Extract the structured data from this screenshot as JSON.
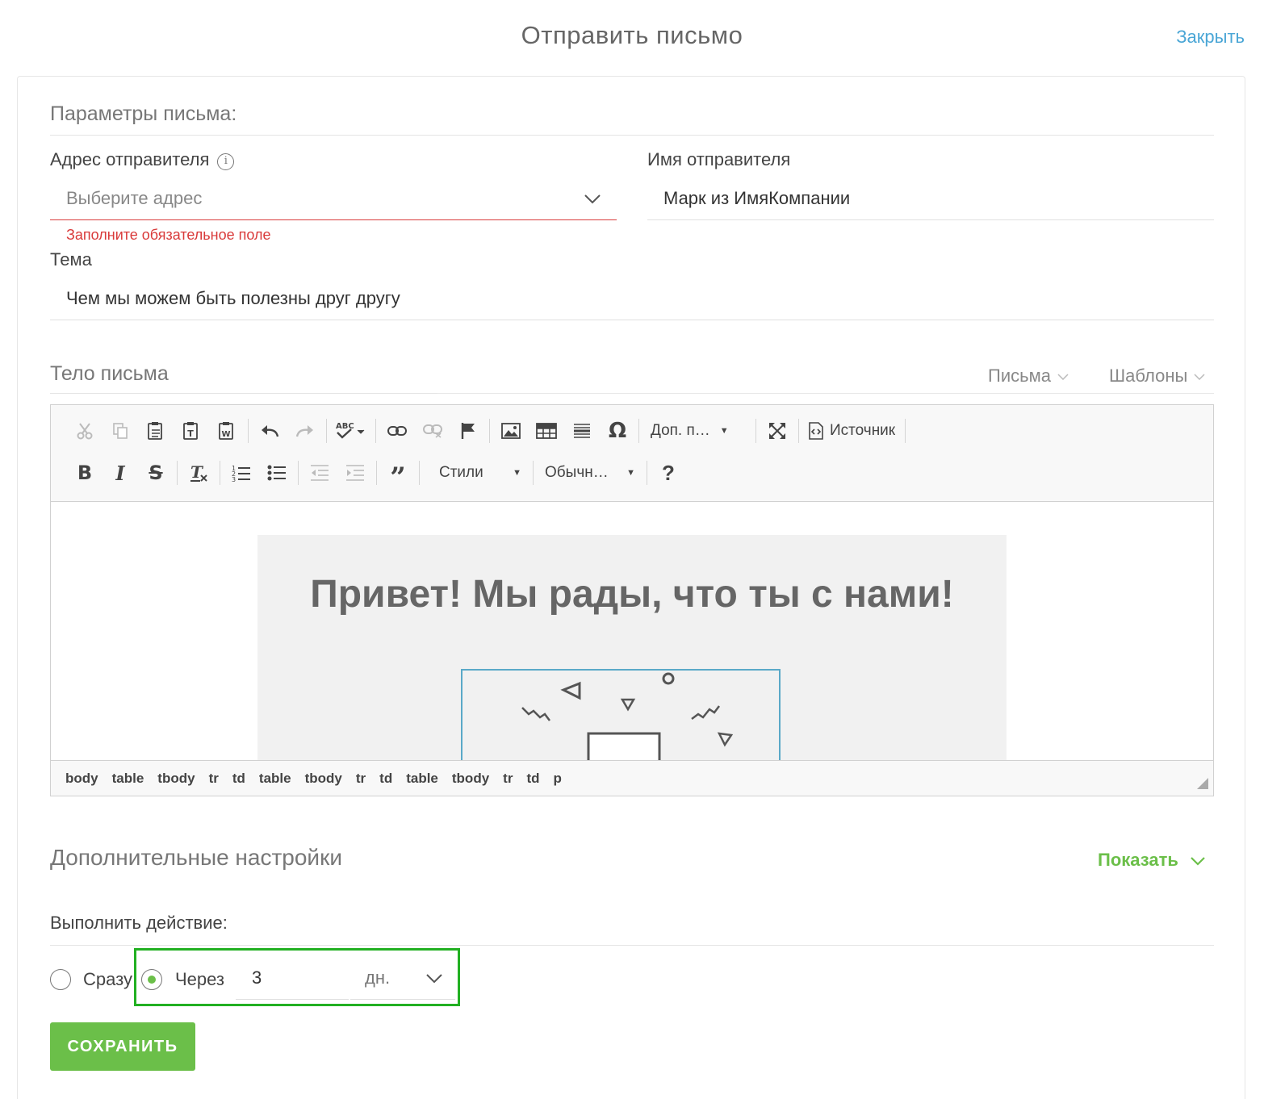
{
  "header": {
    "title": "Отправить письмо",
    "close_label": "Закрыть"
  },
  "params": {
    "section_title": "Параметры письма:",
    "sender_address": {
      "label": "Адрес отправителя",
      "placeholder": "Выберите адрес",
      "error": "Заполните обязательное поле"
    },
    "sender_name": {
      "label": "Имя отправителя",
      "value": "Марк из ИмяКомпании"
    },
    "subject": {
      "label": "Тема",
      "value": "Чем мы можем быть полезны друг другу"
    }
  },
  "body": {
    "section_title": "Тело письма",
    "tabs": [
      "Письма",
      "Шаблоны"
    ],
    "toolbar": {
      "more_label": "Доп. п…",
      "source_label": "Источник",
      "styles_label": "Стили",
      "format_label": "Обычн…",
      "help_label": "?"
    },
    "content_heading": "Привет! Мы рады, что ты с нами!",
    "path": [
      "body",
      "table",
      "tbody",
      "tr",
      "td",
      "table",
      "tbody",
      "tr",
      "td",
      "table",
      "tbody",
      "tr",
      "td",
      "p"
    ]
  },
  "advanced": {
    "title": "Дополнительные настройки",
    "toggle_label": "Показать"
  },
  "action": {
    "label": "Выполнить действие:",
    "option_now": "Сразу",
    "option_after": "Через",
    "selected": "after",
    "delay_value": "3",
    "delay_unit": "дн."
  },
  "save_label": "СОХРАНИТЬ",
  "colors": {
    "accent_green": "#6bbf49",
    "link_blue": "#4aa6d6",
    "error_red": "#d93a3a",
    "highlight": "#22b022"
  }
}
